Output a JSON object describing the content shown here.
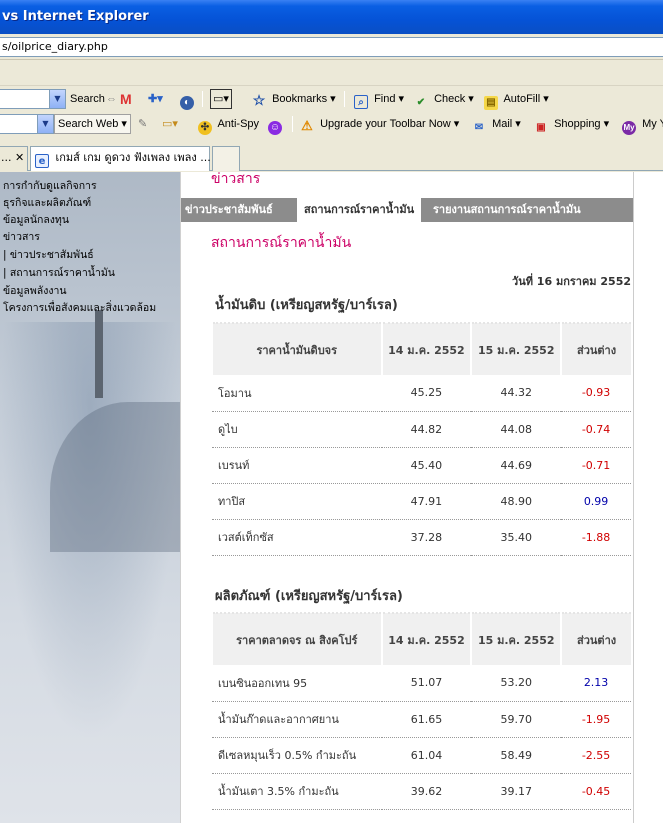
{
  "window": {
    "title": "vs Internet Explorer"
  },
  "address": {
    "url": "s/oilprice_diary.php"
  },
  "toolbar1": {
    "search_label": "Search",
    "bookmarks_label": "Bookmarks",
    "find_label": "Find",
    "check_label": "Check",
    "autofill_label": "AutoFill"
  },
  "toolbar2": {
    "search_web_label": "Search Web",
    "antispy_label": "Anti-Spy",
    "upgrade_label": "Upgrade your Toolbar Now",
    "mail_label": "Mail",
    "shopping_label": "Shopping",
    "my_label": "My Y"
  },
  "tabs": [
    {
      "label": "..."
    },
    {
      "label": "เกมส์ เกม ดูดวง ฟังเพลง เพลง ..."
    }
  ],
  "sidebar": {
    "items": [
      "การกำกับดูแลกิจการ",
      "ธุรกิจและผลิตภัณฑ์",
      "ข้อมูลนักลงทุน",
      "ข่าวสาร",
      "| ข่าวประชาสัมพันธ์",
      "| สถานการณ์ราคาน้ำมัน",
      "ข้อมูลพลังงาน",
      "โครงการเพื่อสังคมและสิ่งแวดล้อม"
    ]
  },
  "content": {
    "headline": "ข่าวสาร",
    "tabs": [
      "ข่าวประชาสัมพันธ์",
      "สถานการณ์ราคาน้ำมัน",
      "รายงานสถานการณ์ราคาน้ำมัน"
    ],
    "section_title": "สถานการณ์ราคาน้ำมัน",
    "date": "วันที่ 16 มกราคม 2552",
    "crude": {
      "title": "น้ำมันดิบ (เหรียญสหรัฐ/บาร์เรล)",
      "headers": [
        "ราคาน้ำมันดิบจร",
        "14 ม.ค. 2552",
        "15 ม.ค. 2552",
        "ส่วนต่าง"
      ],
      "rows": [
        {
          "name": "โอมาน",
          "d14": "45.25",
          "d15": "44.32",
          "diff": "-0.93"
        },
        {
          "name": "ดูไบ",
          "d14": "44.82",
          "d15": "44.08",
          "diff": "-0.74"
        },
        {
          "name": "เบรนท์",
          "d14": "45.40",
          "d15": "44.69",
          "diff": "-0.71"
        },
        {
          "name": "ทาปิส",
          "d14": "47.91",
          "d15": "48.90",
          "diff": "0.99"
        },
        {
          "name": "เวสต์เท็กซัส",
          "d14": "37.28",
          "d15": "35.40",
          "diff": "-1.88"
        }
      ]
    },
    "products": {
      "title": "ผลิตภัณฑ์ (เหรียญสหรัฐ/บาร์เรล)",
      "headers": [
        "ราคาตลาดจร ณ สิงคโปร์",
        "14 ม.ค. 2552",
        "15 ม.ค. 2552",
        "ส่วนต่าง"
      ],
      "rows": [
        {
          "name": "เบนซินออกเทน 95",
          "d14": "51.07",
          "d15": "53.20",
          "diff": "2.13"
        },
        {
          "name": "น้ำมันก๊าดและอากาศยาน",
          "d14": "61.65",
          "d15": "59.70",
          "diff": "-1.95"
        },
        {
          "name": "ดีเซลหมุนเร็ว 0.5% กำมะถัน",
          "d14": "61.04",
          "d15": "58.49",
          "diff": "-2.55"
        },
        {
          "name": "น้ำมันเตา 3.5% กำมะถัน",
          "d14": "39.62",
          "d15": "39.17",
          "diff": "-0.45"
        }
      ]
    }
  },
  "colors": {
    "accent": "#cc0066",
    "negative": "#d00000",
    "positive": "#0000aa",
    "titlebar": "#0a5fe3"
  }
}
